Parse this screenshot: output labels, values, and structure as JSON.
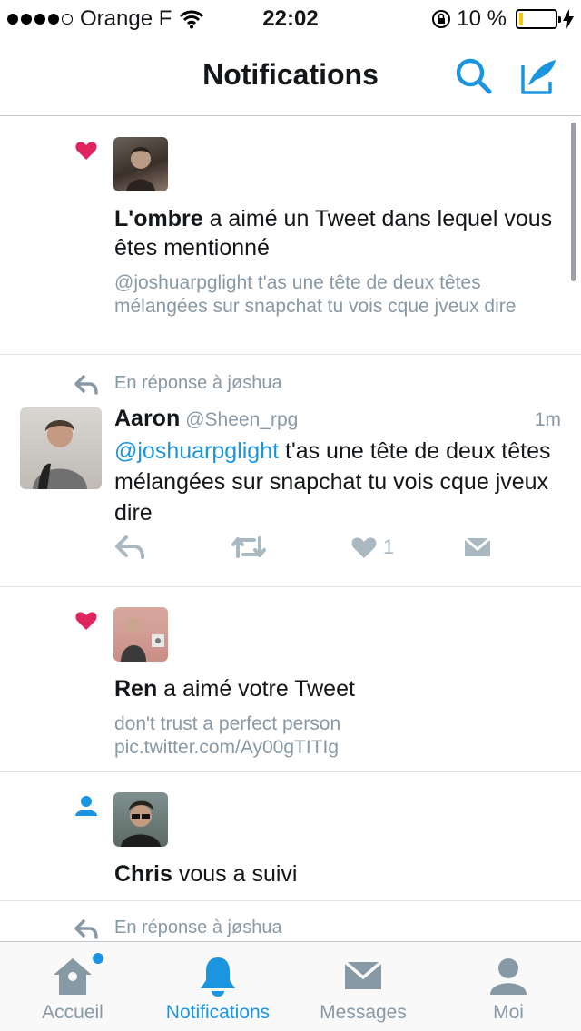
{
  "status_bar": {
    "carrier": "Orange F",
    "time": "22:02",
    "battery_percent": "10 %",
    "battery_level": 0.1
  },
  "header": {
    "title": "Notifications",
    "search_icon": "search-icon",
    "compose_icon": "compose-icon"
  },
  "notifications": [
    {
      "type": "like",
      "user": "L'ombre",
      "action": " a aimé un Tweet dans lequel vous êtes mentionné",
      "excerpt": "@joshuarpglight t'as une tête de deux têtes mélangées sur snapchat tu vois cque jveux dire"
    },
    {
      "type": "reply",
      "context": "En réponse à jøshua",
      "name": "Aaron",
      "handle": "@Sheen_rpg",
      "time": "1m",
      "mention": "@joshuarpglight",
      "text": " t'as une tête de deux têtes mélangées sur snapchat tu vois cque jveux dire",
      "like_count": "1"
    },
    {
      "type": "like",
      "user": "Ren",
      "action": " a aimé votre Tweet",
      "excerpt": "don't trust a perfect person pic.twitter.com/Ay00gTITIg"
    },
    {
      "type": "follow",
      "user": "Chris",
      "action": " vous a suivi"
    },
    {
      "type": "reply",
      "context": "En réponse à jøshua"
    }
  ],
  "tabs": [
    {
      "label": "Accueil",
      "icon": "home-icon",
      "active": false
    },
    {
      "label": "Notifications",
      "icon": "bell-icon",
      "active": true
    },
    {
      "label": "Messages",
      "icon": "envelope-icon",
      "active": false
    },
    {
      "label": "Moi",
      "icon": "person-icon",
      "active": false
    }
  ],
  "colors": {
    "accent": "#1b95e0",
    "heart": "#e0245e",
    "muted": "#8899a6"
  }
}
